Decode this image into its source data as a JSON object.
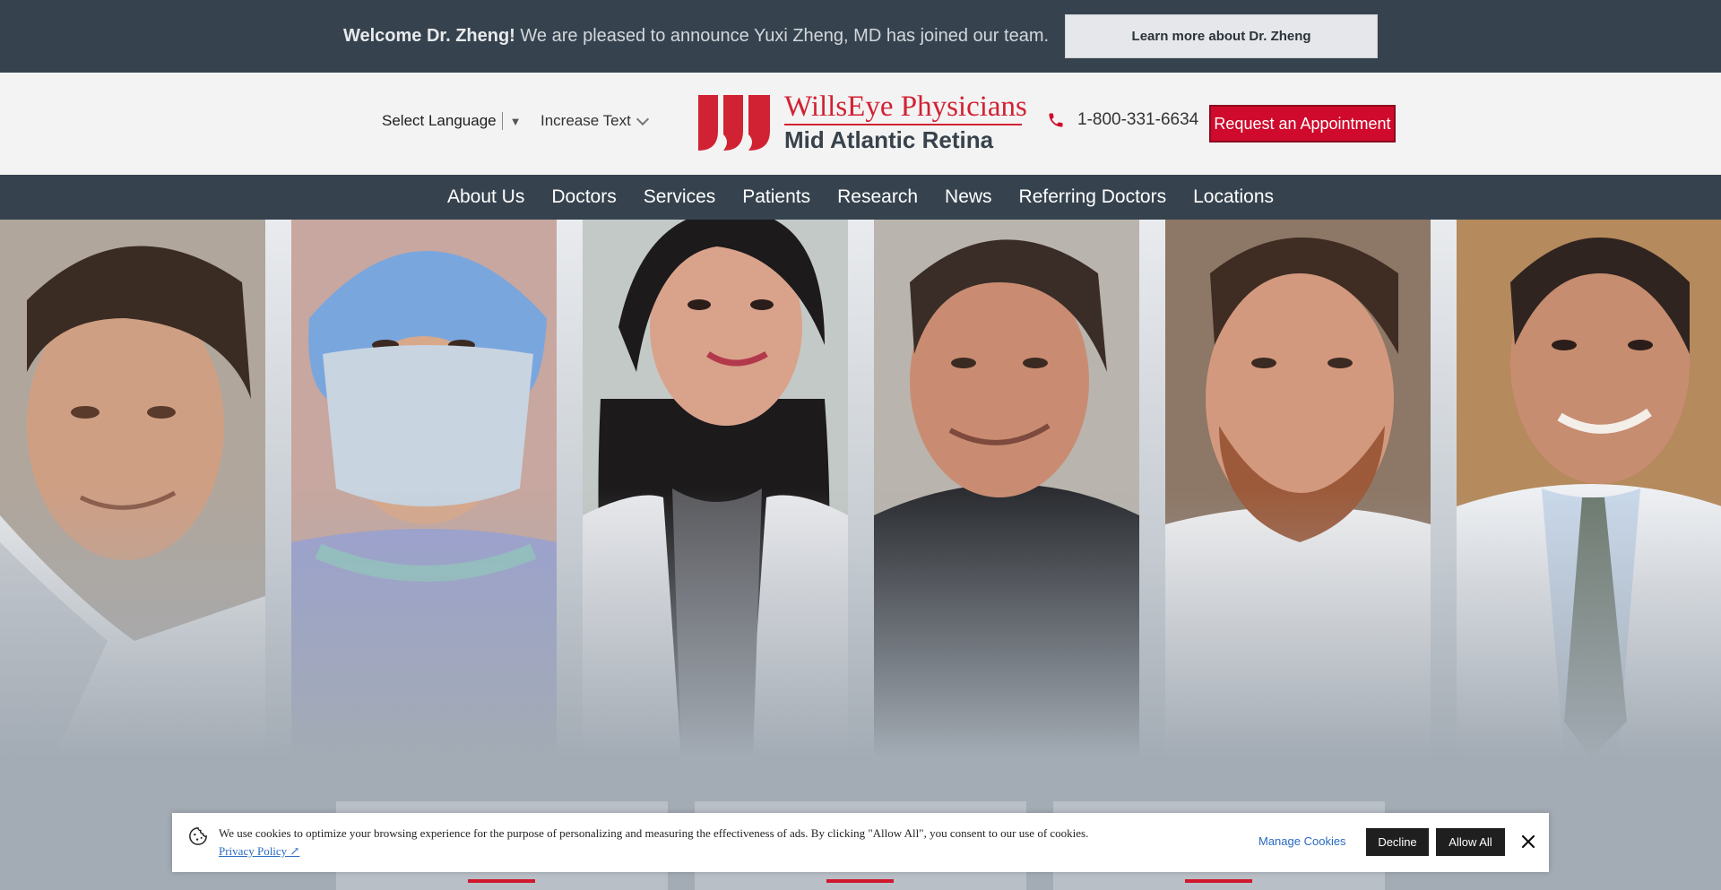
{
  "announcement": {
    "bold": "Welcome Dr. Zheng!",
    "text": "We are pleased to announce Yuxi Zheng, MD has joined our team.",
    "button": "Learn more about Dr. Zheng"
  },
  "header": {
    "language": "Select Language",
    "language_caret": "▼",
    "increase_text": "Increase Text",
    "logo_top": "WillsEye Physicians",
    "logo_bottom": "Mid Atlantic Retina",
    "phone": "1-800-331-6634",
    "appointment": "Request an Appointment"
  },
  "nav": [
    "About Us",
    "Doctors",
    "Services",
    "Patients",
    "Research",
    "News",
    "Referring Doctors",
    "Locations"
  ],
  "colors": {
    "brand_red": "#cf0a2c",
    "dark_slate": "#36434f"
  },
  "cookie": {
    "text": "We use cookies to optimize your browsing experience for the purpose of personalizing and measuring the effectiveness of ads. By clicking \"Allow All\", you consent to our use of cookies.",
    "privacy": "Privacy Policy ↗",
    "manage": "Manage Cookies",
    "decline": "Decline",
    "allow": "Allow All"
  }
}
